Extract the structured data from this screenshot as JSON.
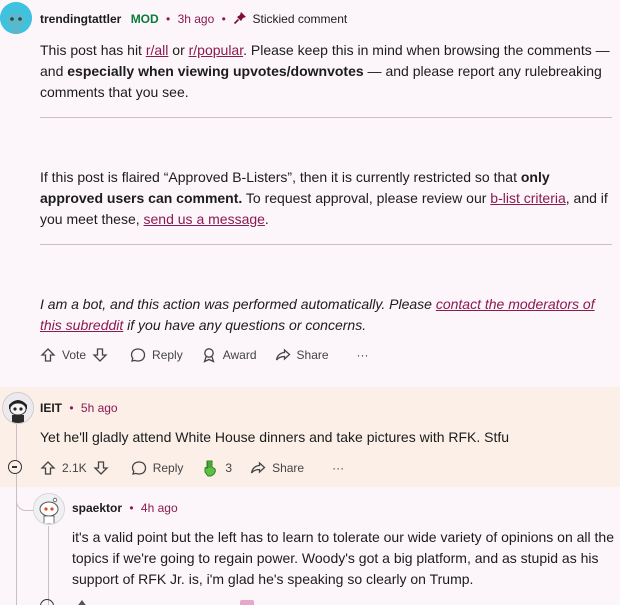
{
  "comment1": {
    "user": "trendingtattler",
    "mod_badge": "MOD",
    "separator": "•",
    "time": "3h ago",
    "stickied": "Stickied comment",
    "p1_a": "This post has hit ",
    "p1_link1": "r/all",
    "p1_b": " or ",
    "p1_link2": "r/popular",
    "p1_c": ". Please keep this in mind when browsing the comments — and ",
    "p1_bold": "especially when viewing upvotes/downvotes",
    "p1_d": " — and please report any rulebreaking comments that you see.",
    "p2_a": "If this post is flaired “Approved B-Listers”, then it is currently restricted so that ",
    "p2_bold": "only approved users can comment.",
    "p2_b": " To request approval, please review our ",
    "p2_link1": "b-list criteria",
    "p2_c": ", and if you meet these, ",
    "p2_link2": "send us a message",
    "p2_d": ".",
    "p3_a": "I am a bot, and this action was performed automatically. Please ",
    "p3_link": "contact the moderators of this subreddit",
    "p3_b": " if you have any questions or concerns.",
    "actions": {
      "vote": "Vote",
      "reply": "Reply",
      "award": "Award",
      "share": "Share",
      "more": "···"
    }
  },
  "comment2": {
    "user": "IEIT",
    "separator": "•",
    "time": "5h ago",
    "text": "Yet he'll gladly attend White House dinners and take pictures with RFK. Stfu",
    "actions": {
      "votes": "2.1K",
      "reply": "Reply",
      "awards": "3",
      "share": "Share",
      "more": "···"
    }
  },
  "comment3": {
    "user": "spaektor",
    "separator": "•",
    "time": "4h ago",
    "text": "it's a valid point but the left has to learn to tolerate our wide variety of opinions on all the topics if we're going to regain power. Woody's got a big platform, and as stupid as his support of RFK Jr. is, i'm glad he's speaking so clearly on Trump."
  }
}
